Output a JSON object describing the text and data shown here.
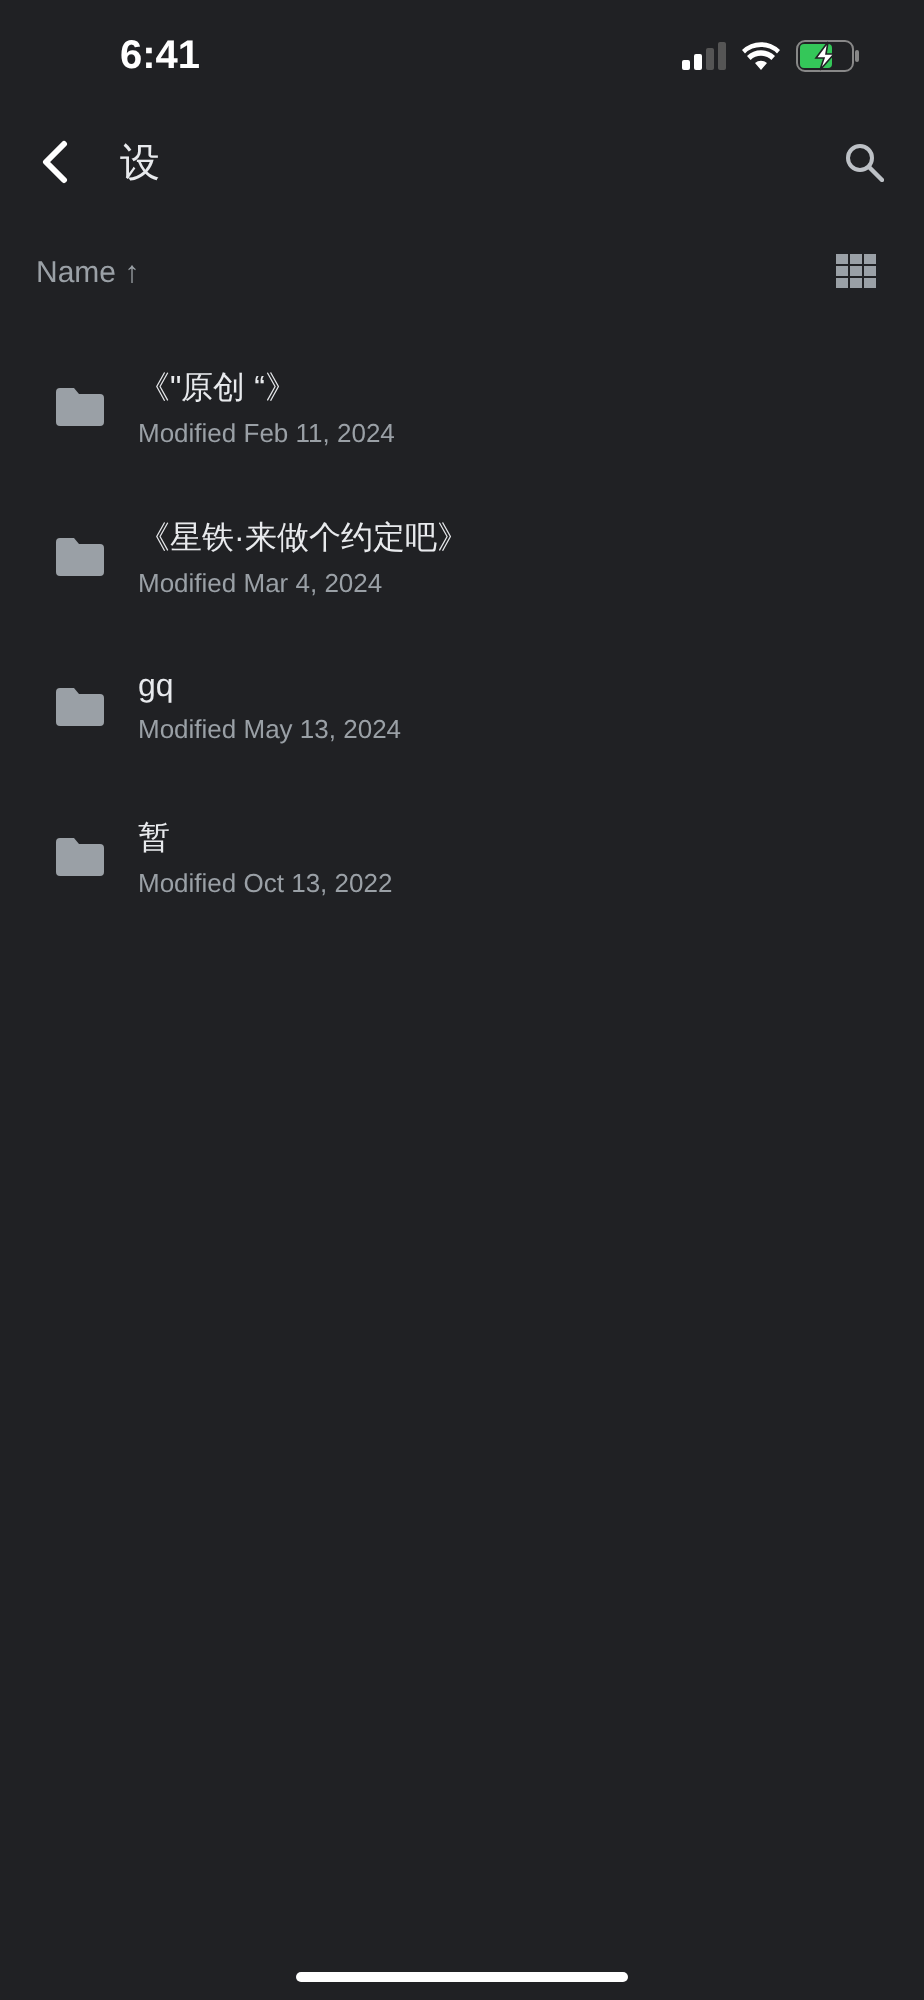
{
  "status_bar": {
    "time": "6:41"
  },
  "header": {
    "title": "设"
  },
  "sort_bar": {
    "label": "Name",
    "arrow": "↑"
  },
  "folders": [
    {
      "name": "《\"原创 “》",
      "modified": "Modified Feb 11, 2024"
    },
    {
      "name": "《星铁·来做个约定吧》",
      "modified": "Modified Mar 4, 2024"
    },
    {
      "name": "gq",
      "modified": "Modified May 13, 2024"
    },
    {
      "name": "暂",
      "modified": "Modified Oct 13, 2022"
    }
  ]
}
